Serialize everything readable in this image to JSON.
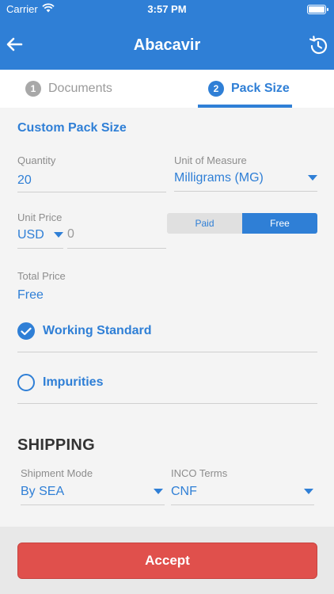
{
  "status_bar": {
    "carrier": "Carrier",
    "time": "3:57 PM"
  },
  "header": {
    "title": "Abacavir"
  },
  "tabs": [
    {
      "number": "1",
      "label": "Documents"
    },
    {
      "number": "2",
      "label": "Pack Size"
    }
  ],
  "form": {
    "section_title": "Custom Pack Size",
    "quantity": {
      "label": "Quantity",
      "value": "20"
    },
    "unit_of_measure": {
      "label": "Unit of Measure",
      "value": "Milligrams (MG)"
    },
    "unit_price": {
      "label": "Unit Price",
      "currency": "USD",
      "amount": "0"
    },
    "payment_toggle": {
      "paid": "Paid",
      "free": "Free",
      "selected": "Free"
    },
    "total_price": {
      "label": "Total Price",
      "value": "Free"
    },
    "working_standard": {
      "label": "Working Standard",
      "checked": true
    },
    "impurities": {
      "label": "Impurities",
      "checked": false
    }
  },
  "shipping": {
    "title": "SHIPPING",
    "shipment_mode": {
      "label": "Shipment Mode",
      "value": "By SEA"
    },
    "inco_terms": {
      "label": "INCO Terms",
      "value": "CNF"
    }
  },
  "footer": {
    "accept_label": "Accept"
  },
  "colors": {
    "primary": "#2f7fd6",
    "accept": "#e0504c"
  }
}
